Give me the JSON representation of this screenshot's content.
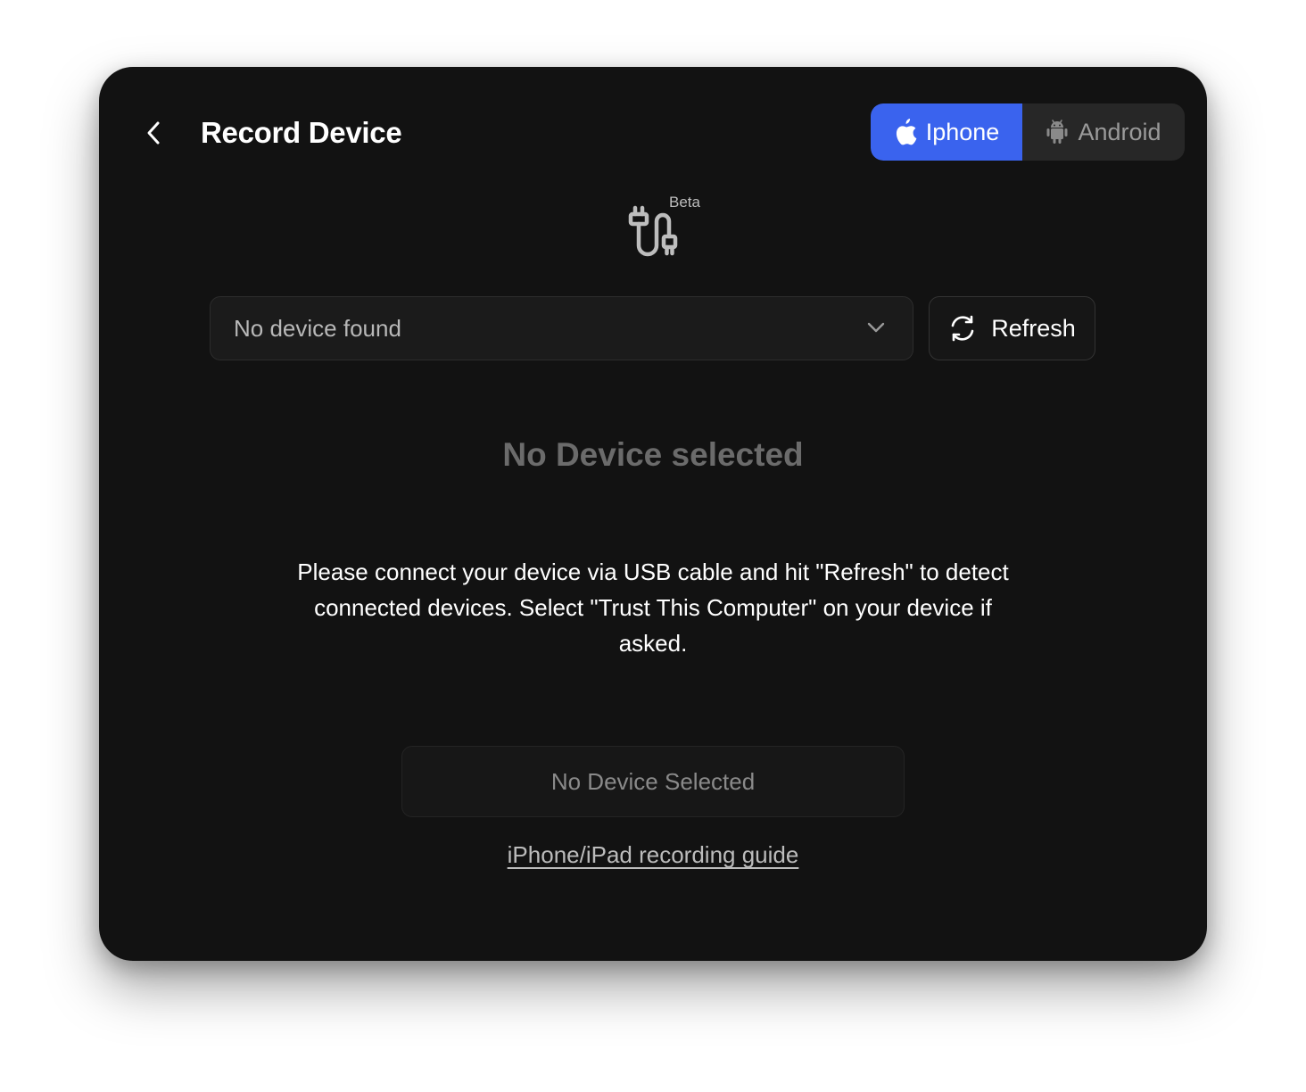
{
  "header": {
    "title": "Record Device",
    "back_icon": "chevron-left-icon"
  },
  "platform_toggle": {
    "options": [
      {
        "label": "Iphone",
        "icon": "apple-icon",
        "selected": true
      },
      {
        "label": "Android",
        "icon": "android-icon",
        "selected": false
      }
    ],
    "accent_color": "#3a63ee"
  },
  "badge": {
    "icon": "usb-cable-icon",
    "label": "Beta"
  },
  "device_select": {
    "value": "No device found",
    "icon": "chevron-down-icon"
  },
  "refresh_button": {
    "label": "Refresh",
    "icon": "refresh-icon"
  },
  "status": {
    "title": "No Device selected",
    "instructions": "Please connect your device via USB cable and hit \"Refresh\" to detect connected devices. Select \"Trust This Computer\" on your device if asked."
  },
  "action_button": {
    "label": "No Device Selected"
  },
  "guide_link": {
    "label": "iPhone/iPad recording guide"
  }
}
